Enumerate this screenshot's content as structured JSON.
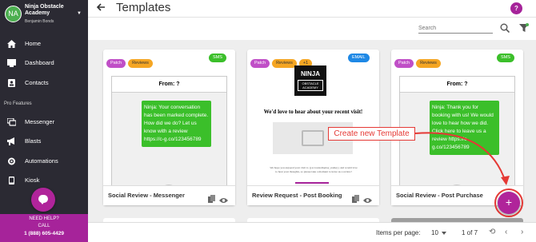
{
  "sidebar": {
    "avatar_initials": "NA",
    "org_name": "Ninja Obstacle Academy",
    "user_name": "Benjamin Bonds",
    "items": [
      {
        "label": "Home",
        "icon": "home-icon"
      },
      {
        "label": "Dashboard",
        "icon": "dashboard-icon"
      },
      {
        "label": "Contacts",
        "icon": "contacts-icon"
      }
    ],
    "section_label": "Pro Features",
    "pro_items": [
      {
        "label": "Messenger",
        "icon": "messenger-icon"
      },
      {
        "label": "Blasts",
        "icon": "megaphone-icon"
      },
      {
        "label": "Automations",
        "icon": "automations-icon"
      },
      {
        "label": "Kiosk",
        "icon": "kiosk-icon"
      }
    ],
    "help": {
      "line1": "NEED HELP?",
      "line2": "CALL",
      "phone": "1 (888) 605-4429"
    }
  },
  "header": {
    "title": "Templates",
    "help_label": "?"
  },
  "toolbar": {
    "search_placeholder": "Search"
  },
  "cards": [
    {
      "tags": [
        "Patch",
        "Reviews"
      ],
      "channel": "SMS",
      "channel_color": "#3bbf2a",
      "from": "From: ?",
      "message": "Ninja: Your conversation has been marked complete. How did we do? Let us know with a review https://c-g.co/123456789",
      "name": "Social Review - Messenger"
    },
    {
      "tags": [
        "Patch",
        "Reviews",
        "+1"
      ],
      "channel": "EMAIL",
      "channel_color": "#1e88e5",
      "logo_top": "NINJA",
      "logo_bottom": "OBSTACLE ACADEMY",
      "heading": "We'd love to hear about your recent visit!",
      "fine_print": "We hope you enjoyed your visit to {{account.display_name}} and would love to hear your thoughts, so please take a moment to leave us a review!",
      "name": "Review Request - Post Booking"
    },
    {
      "tags": [
        "Patch",
        "Reviews"
      ],
      "channel": "SMS",
      "channel_color": "#3bbf2a",
      "from": "From: ?",
      "message": "Ninja: Thank you for booking with us! We would love to hear how we did. Click here to leave us a review https://c-g.co/123456789",
      "name": "Social Review - Post Purchase"
    }
  ],
  "annotation": {
    "text": "Create new Template",
    "color": "#e53935"
  },
  "fab": {
    "label": "+"
  },
  "pagination": {
    "items_per_page_label": "Items per page:",
    "items_per_page": "10",
    "range": "1 of 7"
  },
  "colors": {
    "brand": "#a6239a",
    "sidebar": "#2b2a33",
    "sms": "#3bbf2a",
    "email": "#1e88e5"
  }
}
